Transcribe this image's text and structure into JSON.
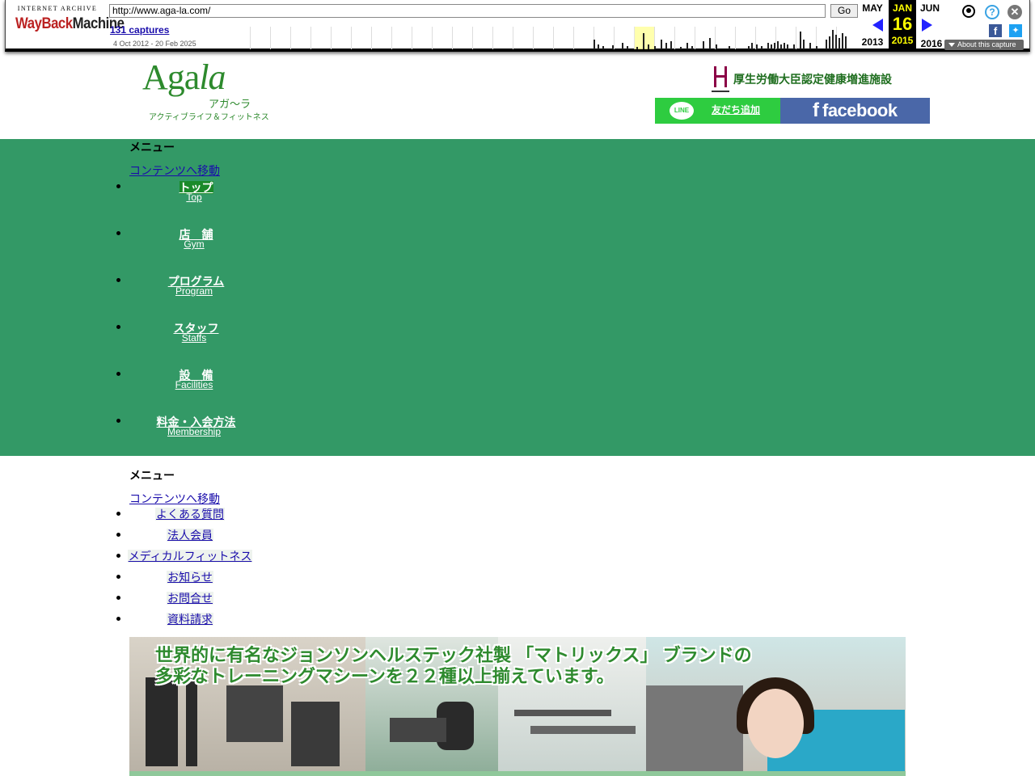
{
  "wayback": {
    "logo_top": "INTERNET ARCHIVE",
    "logo_main_a": "WayBack",
    "logo_main_b": "Machine",
    "url": "http://www.aga-la.com/",
    "go_label": "Go",
    "captures": "131 captures",
    "date_range": "4 Oct 2012 - 20 Feb 2025",
    "prev_month": "MAY",
    "prev_year": "2013",
    "cur_month": "JAN",
    "cur_day": "16",
    "cur_year": "2015",
    "next_month": "JUN",
    "next_year": "2016",
    "about": "About this capture",
    "icons": [
      "user-icon",
      "help-icon",
      "close-icon",
      "facebook-icon",
      "twitter-icon"
    ]
  },
  "header": {
    "logo_text_a": "Aga",
    "logo_text_b": "la",
    "logo_kana": "アガ～ラ",
    "logo_sub": "アクティブライフ＆フィットネス",
    "cert_text": "厚生労働大臣認定健康増進施設",
    "line_label": "友だち追加",
    "line_icon": "LINE",
    "facebook_label": "facebook"
  },
  "main_nav": {
    "menu_heading": "メニュー",
    "skip_link": "コンテンツへ移動",
    "items": [
      {
        "jp": "トップ",
        "en": "Top"
      },
      {
        "jp": "店　舗",
        "en": "Gym"
      },
      {
        "jp": "プログラム",
        "en": "Program"
      },
      {
        "jp": "スタッフ",
        "en": "Staffs"
      },
      {
        "jp": "設　備",
        "en": "Facilities"
      },
      {
        "jp": "料金・入会方法",
        "en": "Membership"
      }
    ]
  },
  "sub_nav": {
    "menu_heading": "メニュー",
    "skip_link": "コンテンツへ移動",
    "items": [
      "よくある質問",
      "法人会員",
      "メディカルフィットネス",
      "お知らせ",
      "お問合せ",
      "資料請求"
    ]
  },
  "banner": {
    "line1": "世界的に有名なジョンソンヘルステック社製 「マトリックス」 ブランドの",
    "line2": "多彩なトレーニングマシーンを２２種以上揃えています。"
  }
}
